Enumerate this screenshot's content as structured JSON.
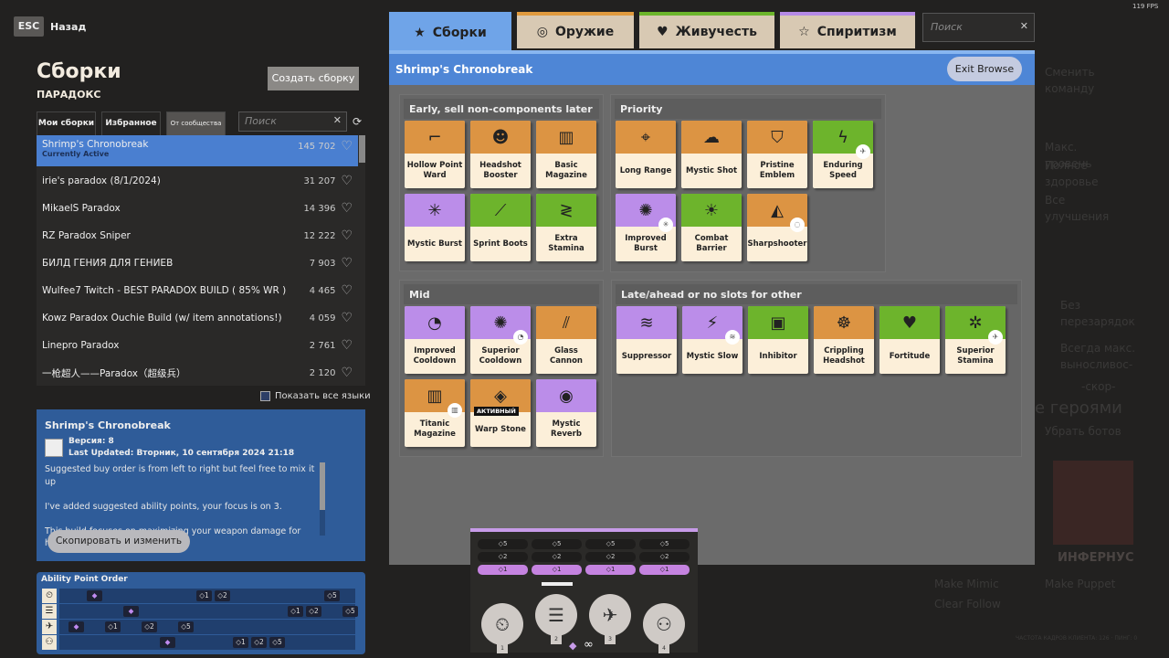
{
  "fps": "119 FPS",
  "nav": {
    "esc": "ESC",
    "back": "Назад"
  },
  "builds": {
    "title": "Сборки",
    "hero": "ПАРАДОКС",
    "create": "Создать сборку",
    "tabs": [
      "Мои сборки",
      "Избранное",
      "От сообщества"
    ],
    "active_tab": 2,
    "search_placeholder": "Поиск",
    "list": [
      {
        "name": "Shrimp's Chronobreak",
        "count": "145 702",
        "sub": "Currently Active",
        "selected": true
      },
      {
        "name": "irie's paradox (8/1/2024)",
        "count": "31 207"
      },
      {
        "name": "MikaelS Paradox",
        "count": "14 396"
      },
      {
        "name": "RZ Paradox Sniper",
        "count": "12 222"
      },
      {
        "name": "БИЛД ГЕНИЯ ДЛЯ ГЕНИЕВ",
        "count": "7 903"
      },
      {
        "name": "Wulfee7 Twitch - BEST PARADOX BUILD ( 85% WR )",
        "count": "4 465"
      },
      {
        "name": "Kowz Paradox Ouchie Build (w/ item annotations!)",
        "count": "4 059"
      },
      {
        "name": "Linepro Paradox",
        "count": "2 761"
      },
      {
        "name": "一枪超人——Paradox（超级兵）",
        "count": "2 120"
      }
    ],
    "show_all_languages": "Показать все языки"
  },
  "detail": {
    "title": "Shrimp's Chronobreak",
    "version": "Версия: 8",
    "updated": "Last Updated: Вторник, 10 сентября 2024 21:18",
    "description": [
      "Suggested buy order is from left to right but feel free to mix it up",
      "I've added suggested ability points, your focus is on 3.",
      "This build focuses on maximizing your weapon damage for high burst Kinetic Carbine."
    ],
    "copy": "Скопировать и изменить"
  },
  "ability_order": {
    "title": "Ability Point Order",
    "rows": [
      {
        "icon": "clock-gear-icon",
        "marks": [
          {
            "step": 1,
            "label": "◆"
          },
          {
            "step": 7,
            "label": "◇1"
          },
          {
            "step": 8,
            "label": "◇2"
          },
          {
            "step": 14,
            "label": "◇5"
          }
        ]
      },
      {
        "icon": "wall-icon",
        "marks": [
          {
            "step": 3,
            "label": "◆"
          },
          {
            "step": 12,
            "label": "◇1"
          },
          {
            "step": 13,
            "label": "◇2"
          },
          {
            "step": 15,
            "label": "◇5"
          }
        ]
      },
      {
        "icon": "carbine-icon",
        "marks": [
          {
            "step": 0,
            "label": "◆"
          },
          {
            "step": 2,
            "label": "◇1"
          },
          {
            "step": 4,
            "label": "◇2"
          },
          {
            "step": 6,
            "label": "◇5"
          }
        ]
      },
      {
        "icon": "swap-icon",
        "marks": [
          {
            "step": 5,
            "label": "◆"
          },
          {
            "step": 9,
            "label": "◇1"
          },
          {
            "step": 10,
            "label": "◇2"
          },
          {
            "step": 11,
            "label": "◇5"
          }
        ]
      }
    ]
  },
  "main": {
    "tabs": [
      {
        "label": "Сборки",
        "icon": "★",
        "color": "#6fa4e8",
        "active": true
      },
      {
        "label": "Оружие",
        "icon": "◎",
        "color": "#e09a3e"
      },
      {
        "label": "Живучесть",
        "icon": "♥",
        "color": "#6cb52b"
      },
      {
        "label": "Спиритизм",
        "icon": "☆",
        "color": "#b58ae6"
      }
    ],
    "search_placeholder": "Поиск",
    "build_title": "Shrimp's Chronobreak",
    "exit": "Exit Browse",
    "colors": {
      "weapon": "#dc9443",
      "vitality": "#6db42c",
      "spirit": "#bb8de9"
    },
    "sections": [
      {
        "title": "Early, sell non-components later",
        "items": [
          {
            "name": "Hollow Point Ward",
            "type": "weapon",
            "icon": "⌐"
          },
          {
            "name": "Headshot Booster",
            "type": "weapon",
            "icon": "☻"
          },
          {
            "name": "Basic Magazine",
            "type": "weapon",
            "icon": "▥"
          },
          {
            "name": "Mystic Burst",
            "type": "spirit",
            "icon": "✳"
          },
          {
            "name": "Sprint Boots",
            "type": "vitality",
            "icon": "⟋"
          },
          {
            "name": "Extra Stamina",
            "type": "vitality",
            "icon": "≷"
          }
        ]
      },
      {
        "title": "Priority",
        "items": [
          {
            "name": "Long Range",
            "type": "weapon",
            "icon": "⌖"
          },
          {
            "name": "Mystic Shot",
            "type": "weapon",
            "icon": "☁"
          },
          {
            "name": "Pristine Emblem",
            "type": "weapon",
            "icon": "⛉"
          },
          {
            "name": "Enduring Speed",
            "type": "vitality",
            "icon": "ϟ",
            "badge": "✈"
          },
          {
            "name": "Improved Burst",
            "type": "spirit",
            "icon": "✺",
            "badge": "✳"
          },
          {
            "name": "Combat Barrier",
            "type": "vitality",
            "icon": "☀"
          },
          {
            "name": "Sharpshooter",
            "type": "weapon",
            "icon": "◭",
            "badge": "◌"
          }
        ]
      },
      {
        "title": "Mid",
        "items": [
          {
            "name": "Improved Cooldown",
            "type": "spirit",
            "icon": "◔"
          },
          {
            "name": "Superior Cooldown",
            "type": "spirit",
            "icon": "✺",
            "badge": "◔"
          },
          {
            "name": "Glass Cannon",
            "type": "weapon",
            "icon": "⫽"
          },
          {
            "name": "Titanic Magazine",
            "type": "weapon",
            "icon": "▥",
            "badge": "▥"
          },
          {
            "name": "Warp Stone",
            "type": "weapon",
            "icon": "◈",
            "active": "АКТИВНЫЙ"
          },
          {
            "name": "Mystic Reverb",
            "type": "spirit",
            "icon": "◉"
          }
        ]
      },
      {
        "title": "Late/ahead or no slots for other",
        "items": [
          {
            "name": "Suppressor",
            "type": "spirit",
            "icon": "≋"
          },
          {
            "name": "Mystic Slow",
            "type": "spirit",
            "icon": "⚡",
            "badge": "≋"
          },
          {
            "name": "Inhibitor",
            "type": "vitality",
            "icon": "▣"
          },
          {
            "name": "Crippling Headshot",
            "type": "weapon",
            "icon": "☸"
          },
          {
            "name": "Fortitude",
            "type": "vitality",
            "icon": "♥"
          },
          {
            "name": "Superior Stamina",
            "type": "vitality",
            "icon": "✲",
            "badge": "✈"
          }
        ]
      }
    ]
  },
  "abilities": {
    "levels": [
      "◇5",
      "◇2",
      "◇1"
    ],
    "unlocked_level": "◇1",
    "slots": [
      {
        "num": "1",
        "icon": "clock-gear-icon",
        "glyph": "⏲"
      },
      {
        "num": "2",
        "icon": "wall-icon",
        "glyph": "☰"
      },
      {
        "num": "3",
        "icon": "carbine-icon",
        "glyph": "✈"
      },
      {
        "num": "4",
        "icon": "swap-icon",
        "glyph": "⚇"
      }
    ]
  },
  "background": {
    "texts": [
      "Сменить команду",
      "Макс. уровень",
      "Полное здоровье",
      "Все улучшения",
      "Без перезарядок",
      "Всегда макс. выносливос-",
      "-скор-",
      "е героями",
      "Убрать ботов",
      "ИНФЕРНУС",
      "Make Mimic",
      "Make Puppet",
      "Clear Follow",
      "ЧАСТОТА КАДРОВ КЛИЕНТА: 126 · ПИНГ: 0"
    ]
  }
}
